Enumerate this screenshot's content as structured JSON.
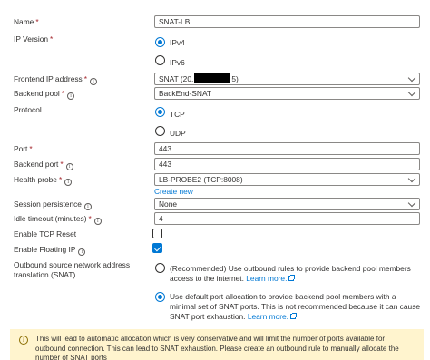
{
  "form": {
    "name": {
      "label": "Name",
      "required": "*",
      "value": "SNAT-LB"
    },
    "ip_version": {
      "label": "IP Version",
      "required": "*",
      "options": [
        "IPv4",
        "IPv6"
      ],
      "selected": "IPv4"
    },
    "frontend_ip": {
      "label": "Frontend IP address",
      "required": "*",
      "value_prefix": "SNAT (20.",
      "value_suffix": "5)"
    },
    "backend_pool": {
      "label": "Backend pool",
      "required": "*",
      "value": "BackEnd-SNAT"
    },
    "protocol": {
      "label": "Protocol",
      "options": [
        "TCP",
        "UDP"
      ],
      "selected": "TCP"
    },
    "port": {
      "label": "Port",
      "required": "*",
      "value": "443"
    },
    "backend_port": {
      "label": "Backend port",
      "required": "*",
      "value": "443"
    },
    "health_probe": {
      "label": "Health probe",
      "required": "*",
      "value": "LB-PROBE2 (TCP:8008)",
      "create_new": "Create new"
    },
    "session_persistence": {
      "label": "Session persistence",
      "value": "None"
    },
    "idle_timeout": {
      "label": "Idle timeout (minutes)",
      "required": "*",
      "value": "4"
    },
    "tcp_reset": {
      "label": "Enable TCP Reset",
      "checked": false
    },
    "floating_ip": {
      "label": "Enable Floating IP",
      "checked": true
    },
    "snat": {
      "label": "Outbound source network address translation (SNAT)",
      "option1_text": "(Recommended) Use outbound rules to provide backend pool members access to the internet.",
      "option1_link": "Learn more.",
      "option2_text": "Use default port allocation to provide backend pool members with a minimal set of SNAT ports. This is not recommended because it can cause SNAT port exhaustion.",
      "option2_link": "Learn more.",
      "selected": 2
    }
  },
  "warning": {
    "icon": "info-icon",
    "text": "This will lead to automatic allocation which is very conservative and will limit the number of ports available for outbound connection. This can lead to SNAT exhaustion. Please create an outbound rule to manually allocate the number of SNAT ports"
  },
  "colors": {
    "accent": "#0078d4",
    "required": "#a4262c",
    "warning_bg": "#fff4ce"
  },
  "icons": {
    "info": "info-icon",
    "chevron": "chevron-down-icon",
    "external": "external-link-icon"
  }
}
